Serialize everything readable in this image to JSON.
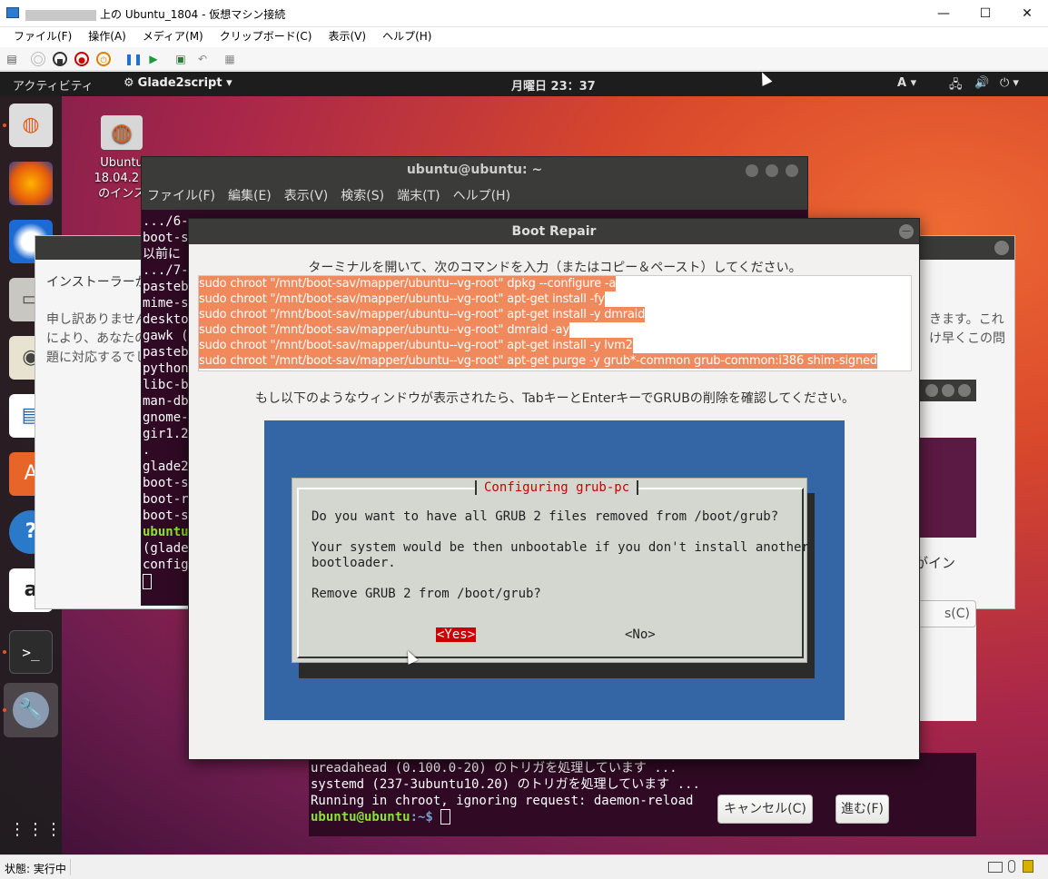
{
  "vm_window": {
    "title_suffix": "上の Ubuntu_1804 - 仮想マシン接続",
    "menu": [
      "ファイル(F)",
      "操作(A)",
      "メディア(M)",
      "クリップボード(C)",
      "表示(V)",
      "ヘルプ(H)"
    ],
    "controls": {
      "minimize": "—",
      "maximize": "☐",
      "close": "✕"
    },
    "status": "状態: 実行中"
  },
  "topbar": {
    "activities": "アクティビティ",
    "app_menu": "Glade2script ▾",
    "clock": "月曜日 23：37",
    "input": "A ▾"
  },
  "desktop_icon": {
    "label_line1": "Ubuntu",
    "label_line2": "18.04.2 L",
    "label_line3": "のインス"
  },
  "installer": {
    "text1": "インストーラーが",
    "text2a": "申し訳ありません",
    "text2a_tail": "きます。これ",
    "text2b": "により、あなたの",
    "text2b_tail": "け早くこの問",
    "text2c": "題に対応するでし",
    "right_text": "がイン",
    "right_button": "s(C)"
  },
  "terminal": {
    "title": "ubuntu@ubuntu: ~",
    "menu": [
      "ファイル(F)",
      "編集(E)",
      "表示(V)",
      "検索(S)",
      "端末(T)",
      "ヘルプ(H)"
    ],
    "lines": [
      ".../6-",
      "boot-s",
      "以前に",
      ".../7-",
      "pasteb",
      "mime-s",
      "deskto",
      "gawk (",
      "pasteb",
      "python",
      "libc-b",
      "man-db",
      "gnome-",
      "gir1.2",
      ".",
      "glade2",
      "boot-s",
      "boot-r",
      "boot-s",
      "ubuntu",
      "",
      "(glade",
      "config"
    ]
  },
  "terminal_bottom": {
    "lines": [
      "ureadahead (0.100.0-20) のトリガを処理しています ...",
      "systemd (237-3ubuntu10.20) のトリガを処理しています ...",
      "Running in chroot, ignoring request: daemon-reload"
    ],
    "prompt_user": "ubuntu@ubuntu",
    "prompt_path": ":~$ "
  },
  "boot_repair": {
    "title": "Boot Repair",
    "instruction": "ターミナルを開いて、次のコマンドを入力（またはコピー＆ペースト）してください。",
    "commands": [
      "sudo chroot \"/mnt/boot-sav/mapper/ubuntu--vg-root\" dpkg --configure -a",
      "sudo chroot \"/mnt/boot-sav/mapper/ubuntu--vg-root\" apt-get install -fy",
      "sudo chroot \"/mnt/boot-sav/mapper/ubuntu--vg-root\" apt-get install -y dmraid",
      "sudo chroot \"/mnt/boot-sav/mapper/ubuntu--vg-root\" dmraid -ay",
      "sudo chroot \"/mnt/boot-sav/mapper/ubuntu--vg-root\" apt-get install -y lvm2",
      "sudo chroot \"/mnt/boot-sav/mapper/ubuntu--vg-root\" apt-get purge -y grub*-common grub-common:i386 shim-signed"
    ],
    "instruction2": "もし以下のようなウィンドウが表示されたら、TabキーとEnterキーでGRUBの削除を確認してください。",
    "grub": {
      "title": "Configuring grub-pc",
      "q1": "Do you want to have all GRUB 2 files removed from /boot/grub?",
      "q2a": "Your system would be then unbootable if you don't install another",
      "q2b": "bootloader.",
      "q3": "Remove GRUB 2 from /boot/grub?",
      "yes": "<Yes>",
      "no": "<No>"
    },
    "cancel": "キャンセル(C)",
    "forward": "進む(F)"
  }
}
